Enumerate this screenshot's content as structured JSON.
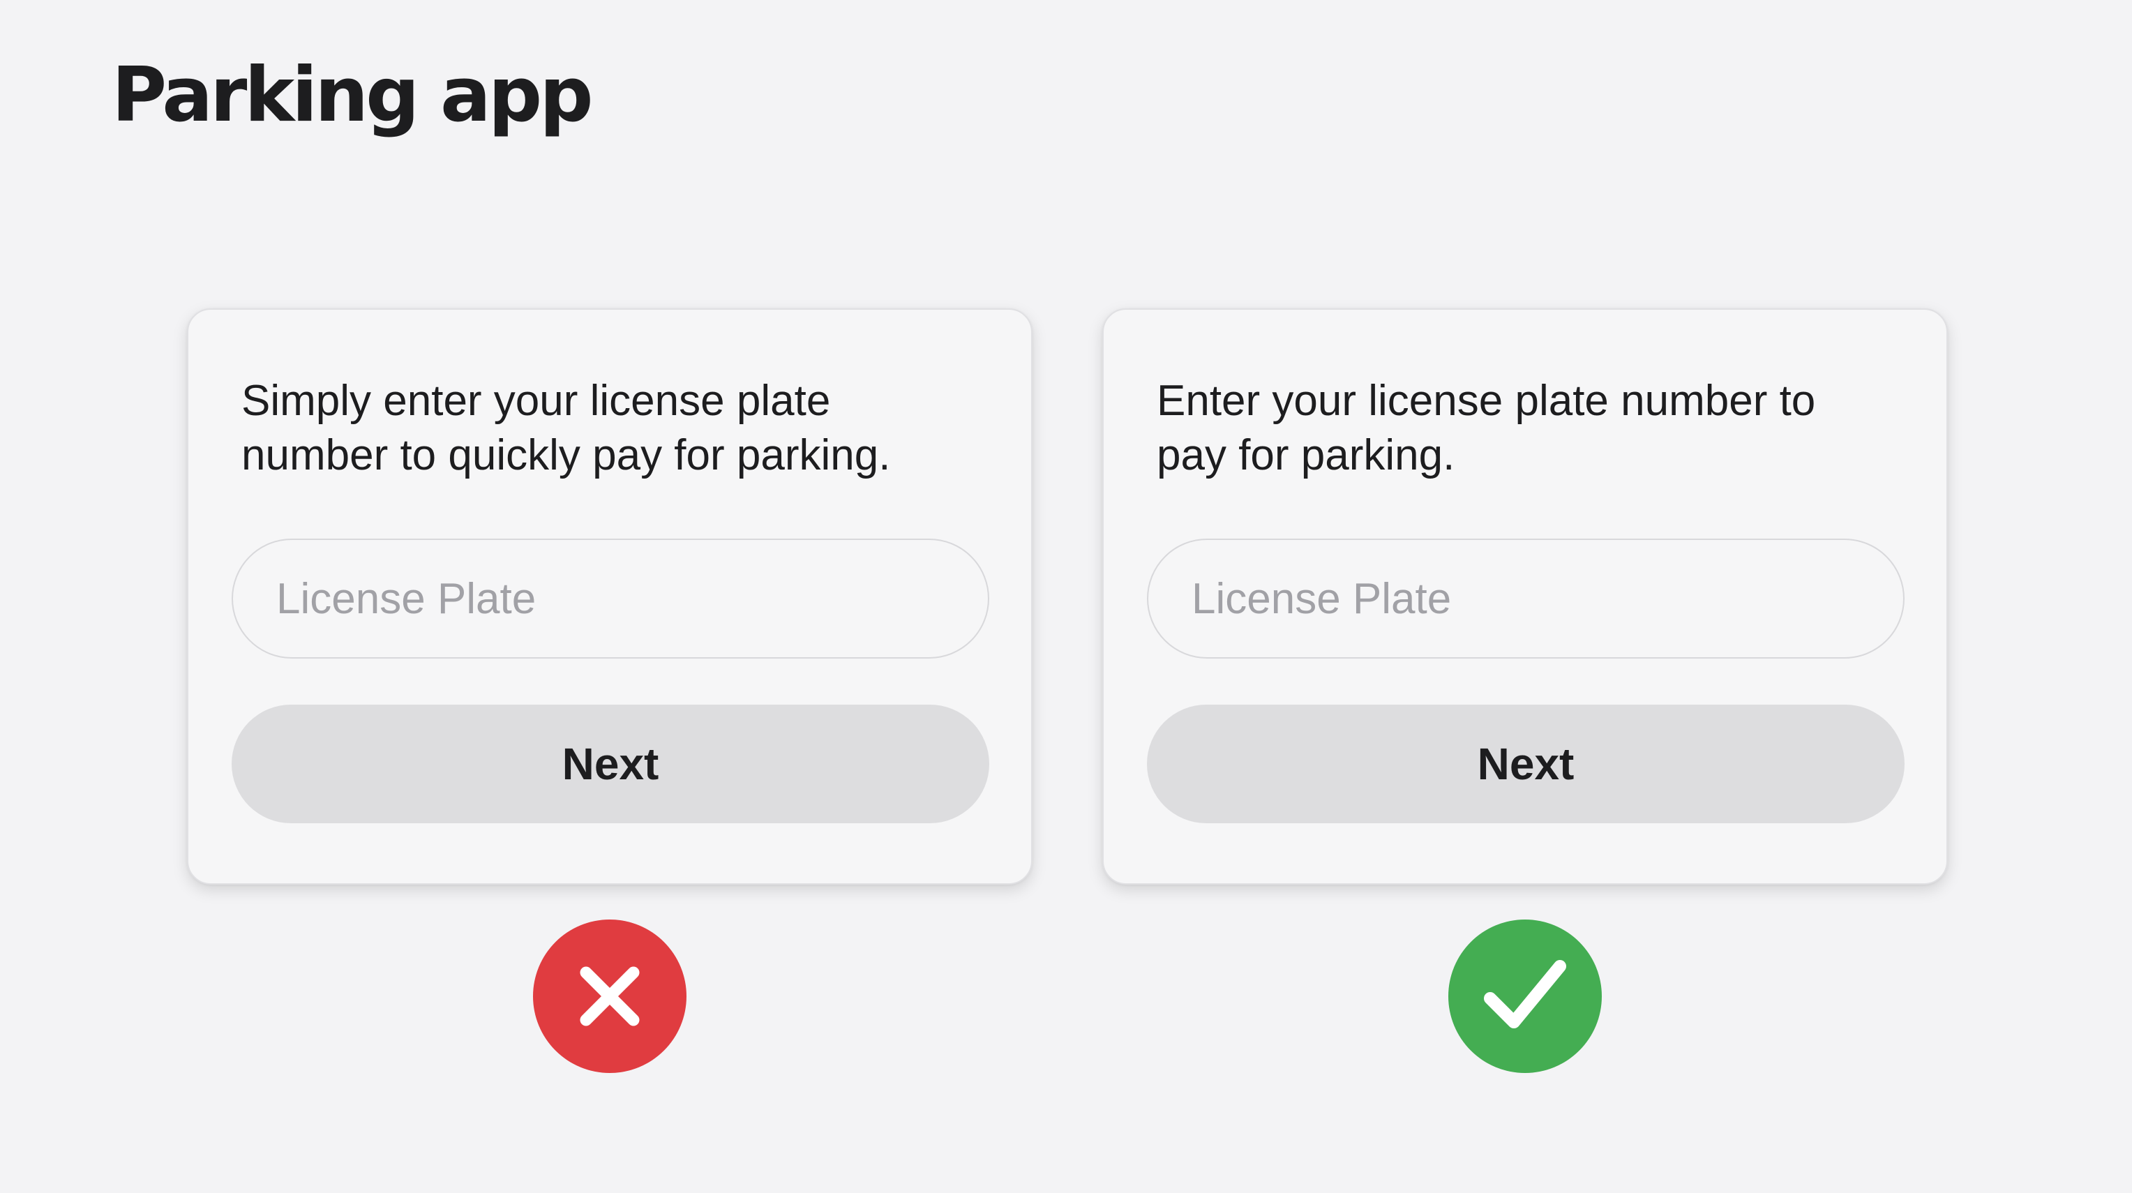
{
  "header": {
    "title": "Parking app"
  },
  "examples": [
    {
      "verdict": "bad",
      "verdict_icon": "x-mark-icon",
      "verdict_color": "#e03c40",
      "message": "Simply enter your license plate number to quickly pay for parking.",
      "input_placeholder": "License Plate",
      "input_value": "",
      "button_label": "Next"
    },
    {
      "verdict": "good",
      "verdict_icon": "checkmark-icon",
      "verdict_color": "#44ad52",
      "message": "Enter your license plate number to pay for parking.",
      "input_placeholder": "License Plate",
      "input_value": "",
      "button_label": "Next"
    }
  ],
  "colors": {
    "background": "#f3f3f5",
    "card": "#f6f6f7",
    "button": "#dddddf",
    "text": "#1d1d1f",
    "placeholder": "#a1a1a6"
  }
}
